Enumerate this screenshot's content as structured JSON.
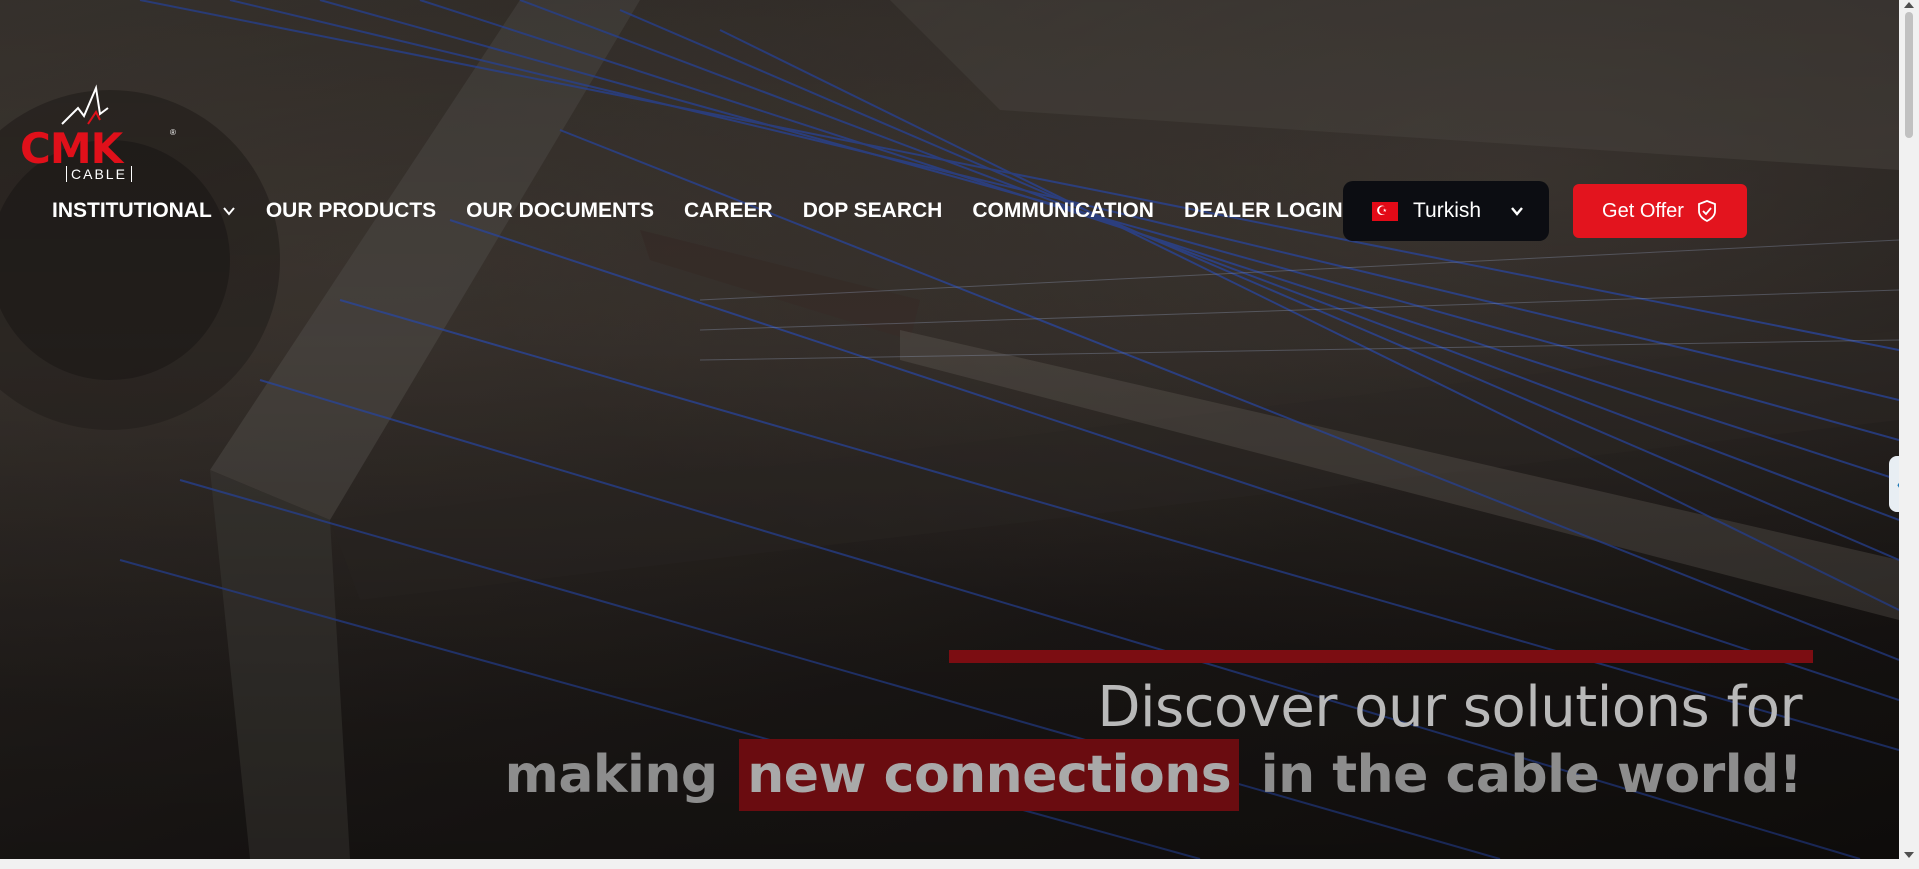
{
  "brand": {
    "name": "CMK",
    "sub": "CABLE",
    "reg_mark": "®",
    "accent_color": "#e3141e"
  },
  "nav": {
    "items": [
      {
        "label": "INSTITUTIONAL",
        "has_dropdown": true
      },
      {
        "label": "OUR PRODUCTS"
      },
      {
        "label": "OUR DOCUMENTS"
      },
      {
        "label": "CAREER"
      },
      {
        "label": "DOP SEARCH"
      },
      {
        "label": "COMMUNICATION"
      },
      {
        "label": "DEALER LOGIN"
      }
    ]
  },
  "language": {
    "selected": "Turkish",
    "flag": "turkey-flag-icon"
  },
  "cta": {
    "label": "Get Offer",
    "icon": "shield-check-icon"
  },
  "hero": {
    "line1": "Discover our solutions for",
    "line2_pre": "making",
    "line2_highlight": "new connections",
    "line2_post": "in the cable world!"
  },
  "side_tab": {
    "glyph": "❮"
  }
}
